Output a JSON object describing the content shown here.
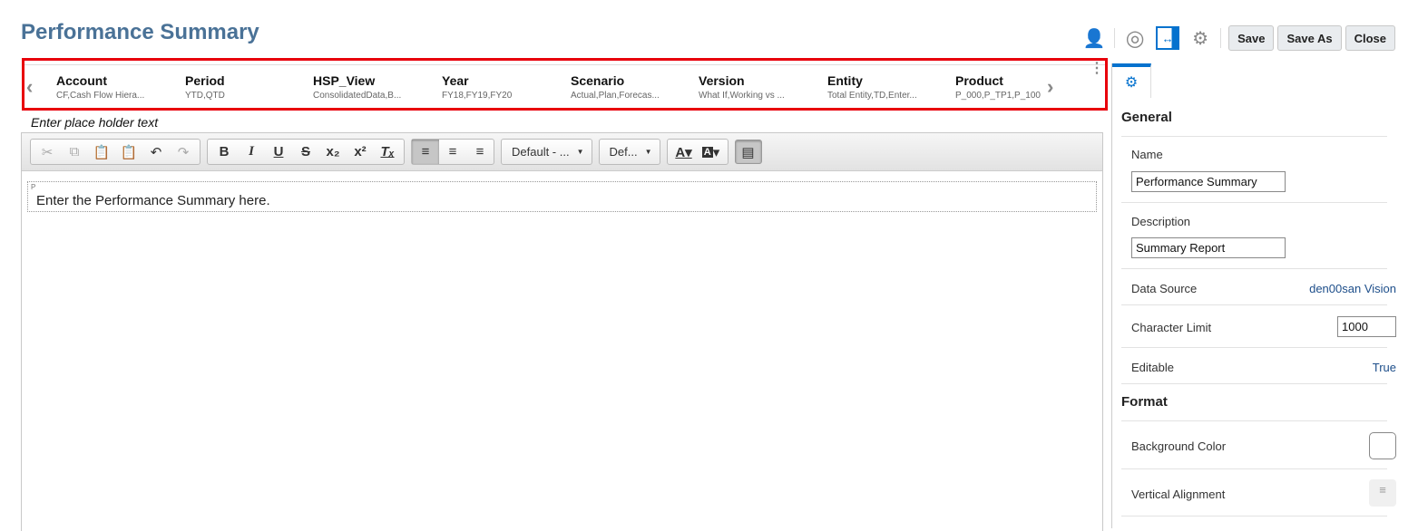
{
  "title": "Performance Summary",
  "toolbar": {
    "save": "Save",
    "save_as": "Save As",
    "close": "Close"
  },
  "pov": [
    {
      "name": "Account",
      "value": "CF,Cash Flow Hiera..."
    },
    {
      "name": "Period",
      "value": "YTD,QTD"
    },
    {
      "name": "HSP_View",
      "value": "ConsolidatedData,B..."
    },
    {
      "name": "Year",
      "value": "FY18,FY19,FY20"
    },
    {
      "name": "Scenario",
      "value": "Actual,Plan,Forecas..."
    },
    {
      "name": "Version",
      "value": "What If,Working vs ..."
    },
    {
      "name": "Entity",
      "value": "Total Entity,TD,Enter..."
    },
    {
      "name": "Product",
      "value": "P_000,P_TP1,P_100"
    }
  ],
  "placeholder": "Enter place holder text",
  "editor": {
    "font_family": "Default - ...",
    "font_size": "Def...",
    "block_tag": "P",
    "content": "Enter the Performance Summary here."
  },
  "panel": {
    "general": "General",
    "name_label": "Name",
    "name_value": "Performance Summary",
    "desc_label": "Description",
    "desc_value": "Summary Report",
    "ds_label": "Data Source",
    "ds_value": "den00san Vision",
    "cl_label": "Character Limit",
    "cl_value": "1000",
    "ed_label": "Editable",
    "ed_value": "True",
    "format": "Format",
    "bg_label": "Background Color",
    "va_label": "Vertical Alignment"
  },
  "colors": {
    "accent": "#0572ce",
    "highlight": "#e8000b",
    "title": "#4a7297"
  }
}
